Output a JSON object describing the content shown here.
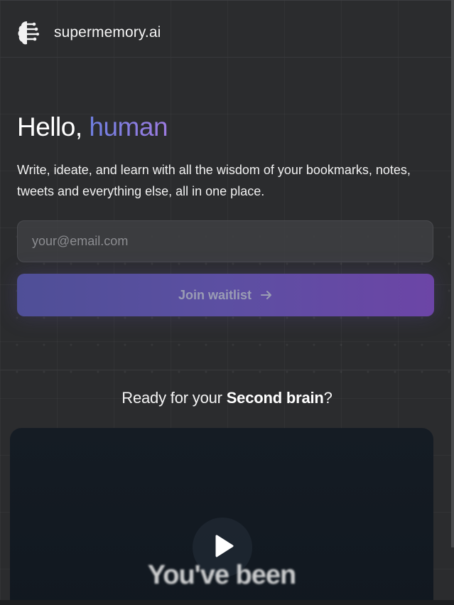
{
  "header": {
    "logo_icon": "brain-icon",
    "brand": "supermemory.ai"
  },
  "hero": {
    "greeting": "Hello,",
    "name": "human",
    "description": "Write, ideate, and learn with all the wisdom of your bookmarks, notes, tweets and everything else, all in one place."
  },
  "form": {
    "email_placeholder": "your@email.com",
    "email_value": "",
    "submit_label": "Join waitlist",
    "submit_icon": "arrow-right-icon"
  },
  "section": {
    "prefix": "Ready for your ",
    "highlight": "Second brain",
    "suffix": "?"
  },
  "video": {
    "play_icon": "play-icon",
    "caption": "You've been"
  },
  "colors": {
    "accent_start": "#6f7fe0",
    "accent_end": "#9c7be0",
    "button_start": "#4f4f97",
    "button_end": "#6c45a6",
    "background": "#2b2c2e"
  }
}
